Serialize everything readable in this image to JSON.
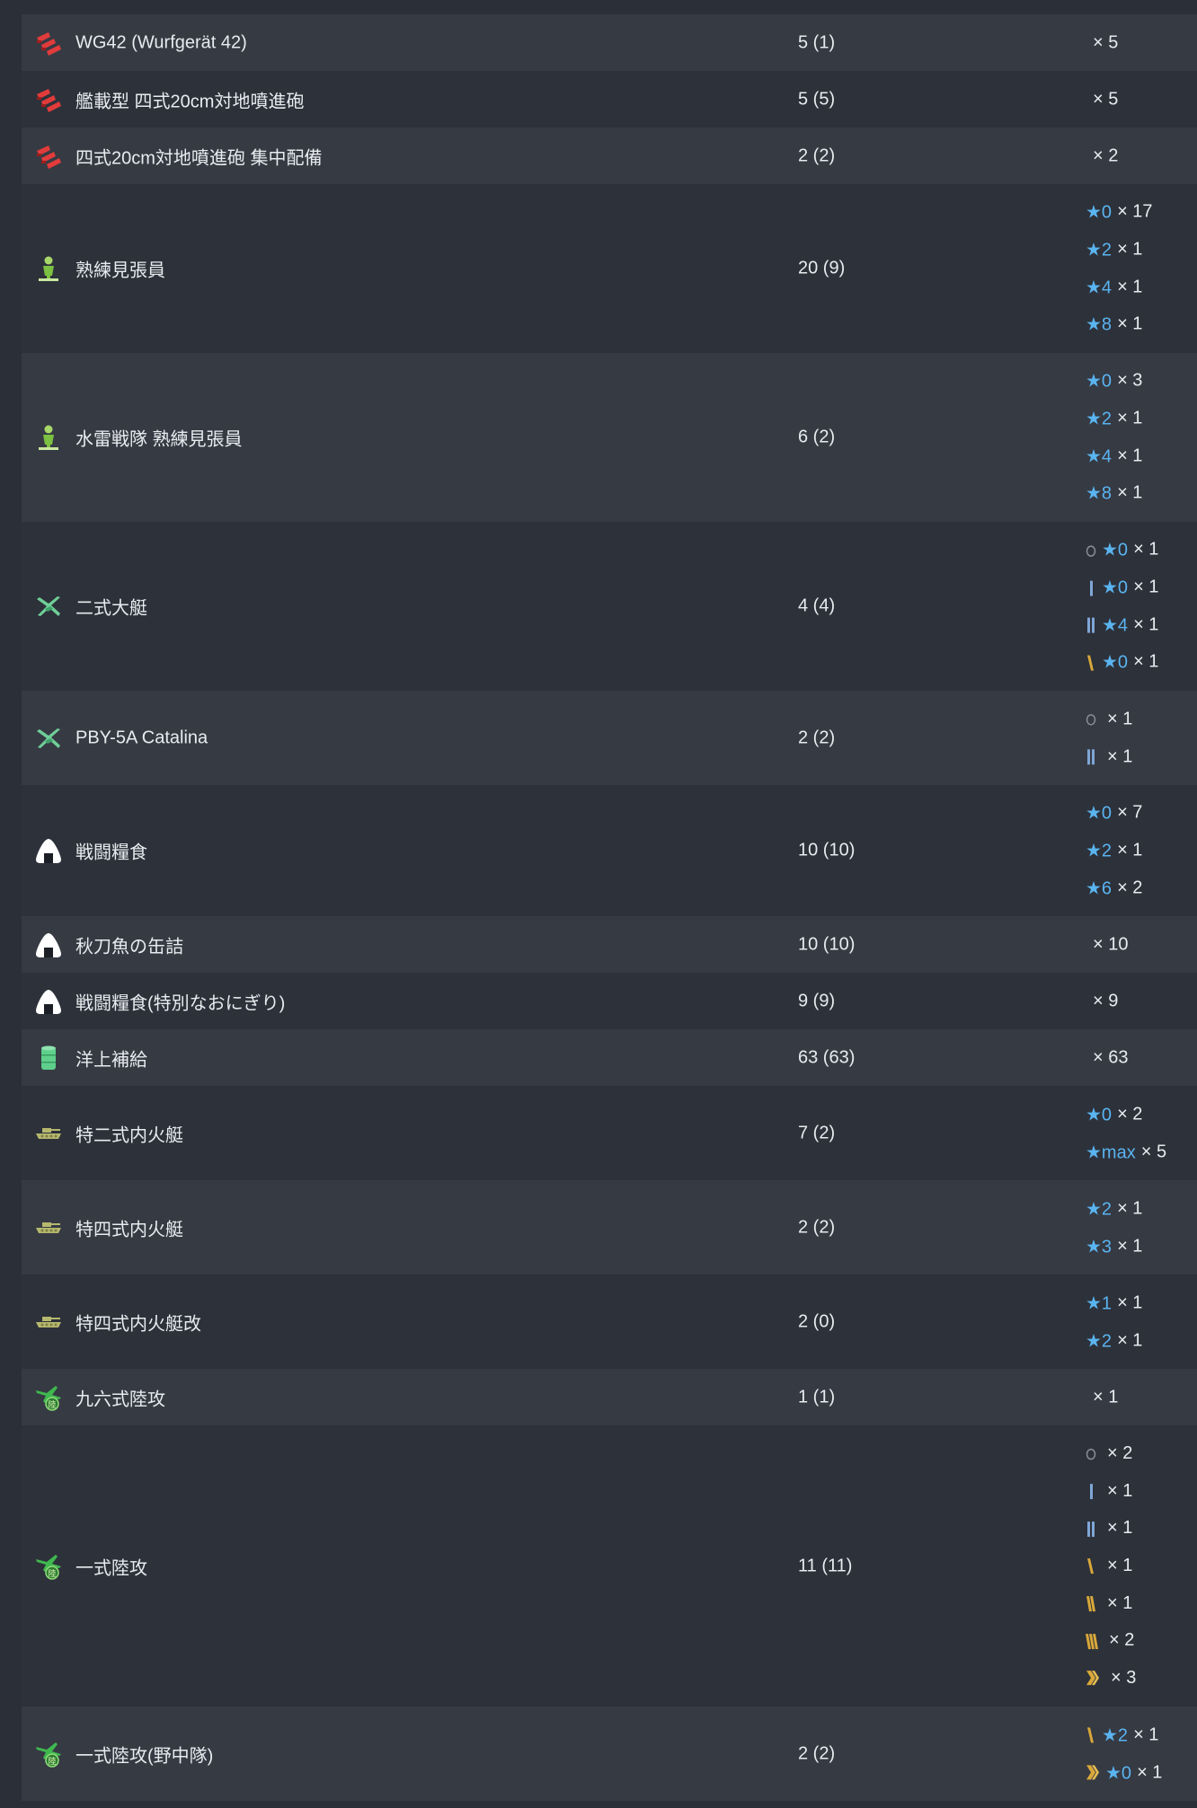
{
  "rows": [
    {
      "name": "WG42 (Wurfgerät 42)",
      "icon": "rocket-launcher-icon",
      "count": "5 (1)",
      "h": 63,
      "details": [
        {
          "mult": "× 5"
        }
      ]
    },
    {
      "name": "艦載型 四式20cm対地噴進砲",
      "icon": "rocket-launcher-icon",
      "count": "5 (5)",
      "h": 63,
      "details": [
        {
          "mult": "× 5"
        }
      ]
    },
    {
      "name": "四式20cm対地噴進砲 集中配備",
      "icon": "rocket-launcher-icon",
      "count": "2 (2)",
      "h": 63,
      "details": [
        {
          "mult": "× 2"
        }
      ]
    },
    {
      "name": "熟練見張員",
      "icon": "lookout-icon",
      "count": "20 (9)",
      "h": 188,
      "details": [
        {
          "star": "★0",
          "mult": "× 17"
        },
        {
          "star": "★2",
          "mult": "× 1"
        },
        {
          "star": "★4",
          "mult": "× 1"
        },
        {
          "star": "★8",
          "mult": "× 1"
        }
      ]
    },
    {
      "name": "水雷戦隊 熟練見張員",
      "icon": "lookout-icon",
      "count": "6 (2)",
      "h": 188,
      "details": [
        {
          "star": "★0",
          "mult": "× 3"
        },
        {
          "star": "★2",
          "mult": "× 1"
        },
        {
          "star": "★4",
          "mult": "× 1"
        },
        {
          "star": "★8",
          "mult": "× 1"
        }
      ]
    },
    {
      "name": "二式大艇",
      "icon": "flying-boat-icon",
      "count": "4 (4)",
      "h": 188,
      "details": [
        {
          "prof": "prof-0-icon",
          "star": "★0",
          "mult": "× 1"
        },
        {
          "prof": "prof-1-icon",
          "star": "★0",
          "mult": "× 1"
        },
        {
          "prof": "prof-2-icon",
          "star": "★4",
          "mult": "× 1"
        },
        {
          "prof": "prof-4-icon",
          "star": "★0",
          "mult": "× 1"
        }
      ]
    },
    {
      "name": "PBY-5A Catalina",
      "icon": "flying-boat-icon",
      "count": "2 (2)",
      "h": 105,
      "details": [
        {
          "prof": "prof-0-icon",
          "mult": "× 1"
        },
        {
          "prof": "prof-2-icon",
          "mult": "× 1"
        }
      ]
    },
    {
      "name": "戦闘糧食",
      "icon": "ration-icon",
      "count": "10 (10)",
      "h": 146,
      "details": [
        {
          "star": "★0",
          "mult": "× 7"
        },
        {
          "star": "★2",
          "mult": "× 1"
        },
        {
          "star": "★6",
          "mult": "× 2"
        }
      ]
    },
    {
      "name": "秋刀魚の缶詰",
      "icon": "ration-icon",
      "count": "10 (10)",
      "h": 63,
      "details": [
        {
          "mult": "× 10"
        }
      ]
    },
    {
      "name": "戦闘糧食(特別なおにぎり)",
      "icon": "ration-icon",
      "count": "9 (9)",
      "h": 63,
      "details": [
        {
          "mult": "× 9"
        }
      ]
    },
    {
      "name": "洋上補給",
      "icon": "supply-drum-icon",
      "count": "63 (63)",
      "h": 63,
      "details": [
        {
          "mult": "× 63"
        }
      ]
    },
    {
      "name": "特二式内火艇",
      "icon": "amphibious-tank-icon",
      "count": "7 (2)",
      "h": 105,
      "details": [
        {
          "star": "★0",
          "mult": "× 2"
        },
        {
          "star": "★max",
          "mult": "× 5"
        }
      ]
    },
    {
      "name": "特四式内火艇",
      "icon": "amphibious-tank-icon",
      "count": "2 (2)",
      "h": 105,
      "details": [
        {
          "star": "★2",
          "mult": "× 1"
        },
        {
          "star": "★3",
          "mult": "× 1"
        }
      ]
    },
    {
      "name": "特四式内火艇改",
      "icon": "amphibious-tank-icon",
      "count": "2 (0)",
      "h": 105,
      "details": [
        {
          "star": "★1",
          "mult": "× 1"
        },
        {
          "star": "★2",
          "mult": "× 1"
        }
      ]
    },
    {
      "name": "九六式陸攻",
      "icon": "land-attacker-icon",
      "count": "1 (1)",
      "h": 63,
      "details": [
        {
          "mult": "× 1"
        }
      ]
    },
    {
      "name": "一式陸攻",
      "icon": "land-attacker-icon",
      "count": "11 (11)",
      "h": 313,
      "details": [
        {
          "prof": "prof-0-icon",
          "mult": "× 2"
        },
        {
          "prof": "prof-1-icon",
          "mult": "× 1"
        },
        {
          "prof": "prof-2-icon",
          "mult": "× 1"
        },
        {
          "prof": "prof-4-icon",
          "mult": "× 1"
        },
        {
          "prof": "prof-5-icon",
          "mult": "× 1"
        },
        {
          "prof": "prof-6-icon",
          "mult": "× 2"
        },
        {
          "prof": "prof-7-icon",
          "mult": "× 3"
        }
      ]
    },
    {
      "name": "一式陸攻(野中隊)",
      "icon": "land-attacker-icon",
      "count": "2 (2)",
      "h": 105,
      "details": [
        {
          "prof": "prof-4-icon",
          "star": "★2",
          "mult": "× 1"
        },
        {
          "prof": "prof-7-icon",
          "star": "★0",
          "mult": "× 1"
        }
      ]
    }
  ],
  "colors": {
    "star": "#5ab4f0",
    "prof_blue": "#7fa6d6",
    "prof_gold": "#d9a83a",
    "row_odd": "#363a43",
    "row_even": "#2d313a"
  }
}
